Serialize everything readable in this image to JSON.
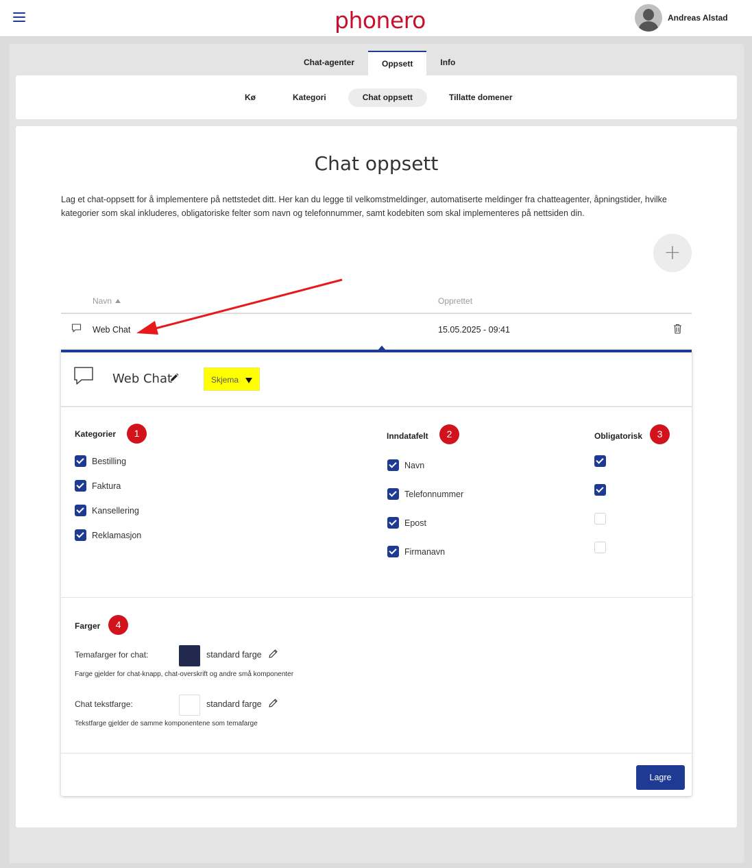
{
  "header": {
    "logo": "phonero",
    "user_name": "Andreas Alstad"
  },
  "tabs": [
    {
      "label": "Chat-agenter",
      "active": false
    },
    {
      "label": "Oppsett",
      "active": true
    },
    {
      "label": "Info",
      "active": false
    }
  ],
  "subnav": [
    {
      "label": "Kø",
      "active": false
    },
    {
      "label": "Kategori",
      "active": false
    },
    {
      "label": "Chat oppsett",
      "active": true
    },
    {
      "label": "Tillatte domener",
      "active": false
    }
  ],
  "page": {
    "title": "Chat oppsett",
    "intro": "Lag et chat-oppsett for å implementere på nettstedet ditt. Her kan du legge til velkomstmeldinger, automatiserte meldinger fra chatteagenter, åpningstider, hvilke kategorier som skal inkluderes, obligatoriske felter som navn og telefonnummer, samt kodebiten som skal implementeres på nettsiden din.",
    "add_label": "+"
  },
  "table": {
    "col_name": "Navn",
    "col_created": "Opprettet",
    "rows": [
      {
        "name": "Web Chat",
        "created": "15.05.2025 - 09:41"
      }
    ]
  },
  "panel": {
    "title": "Web Chat",
    "dropdown_value": "Skjema",
    "categories": {
      "label": "Kategorier",
      "badge": "1",
      "items": [
        {
          "label": "Bestilling",
          "checked": true
        },
        {
          "label": "Faktura",
          "checked": true
        },
        {
          "label": "Kansellering",
          "checked": true
        },
        {
          "label": "Reklamasjon",
          "checked": true
        }
      ]
    },
    "input_fields": {
      "label": "Inndatafelt",
      "badge": "2",
      "items": [
        {
          "label": "Navn",
          "checked": true
        },
        {
          "label": "Telefonnummer",
          "checked": true
        },
        {
          "label": "Epost",
          "checked": true
        },
        {
          "label": "Firmanavn",
          "checked": true
        }
      ]
    },
    "mandatory": {
      "label": "Obligatorisk",
      "badge": "3",
      "items": [
        {
          "checked": true
        },
        {
          "checked": true
        },
        {
          "checked": false
        },
        {
          "checked": false
        }
      ]
    },
    "colors": {
      "label": "Farger",
      "badge": "4",
      "theme_label": "Temafarger for chat:",
      "theme_value": "standard farge",
      "theme_color": "#22294f",
      "theme_hint": "Farge gjelder for chat-knapp, chat-overskrift og andre små komponenter",
      "text_label": "Chat tekstfarge:",
      "text_value": "standard farge",
      "text_color": "#ffffff",
      "text_hint": "Tekstfarge gjelder de samme komponentene som temafarge"
    },
    "save_label": "Lagre"
  },
  "colors": {
    "accent": "#1f3a93",
    "brand": "#c8102e",
    "badge": "#d3131b",
    "highlight": "#ffff00"
  }
}
